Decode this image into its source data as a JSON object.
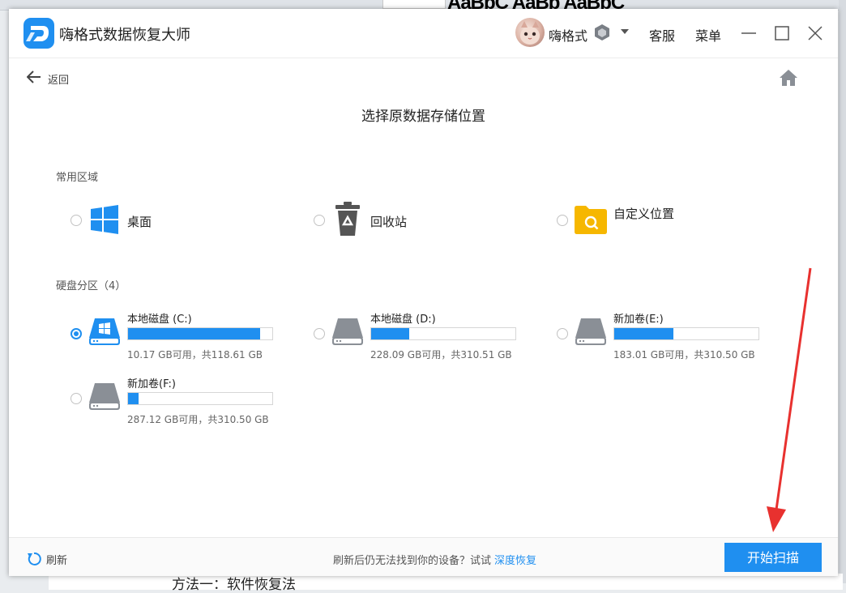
{
  "app": {
    "title": "嗨格式数据恢复大师",
    "user_name": "嗨格式",
    "service_label": "客服",
    "menu_label": "菜单"
  },
  "nav": {
    "back_label": "返回"
  },
  "page": {
    "title": "选择原数据存储位置"
  },
  "common_section": {
    "label": "常用区域",
    "items": [
      {
        "label": "桌面",
        "icon": "windows-icon",
        "selected": false
      },
      {
        "label": "回收站",
        "icon": "recycle-bin-icon",
        "selected": false
      },
      {
        "label": "自定义位置",
        "icon": "folder-search-icon",
        "selected": false
      }
    ]
  },
  "disk_section": {
    "label": "硬盘分区（4）",
    "drives": [
      {
        "name": "本地磁盘 (C:)",
        "info": "10.17 GB可用，共118.61 GB",
        "used_fraction": 0.914,
        "selected": true,
        "system": true
      },
      {
        "name": "本地磁盘 (D:)",
        "info": "228.09 GB可用，共310.51 GB",
        "used_fraction": 0.265,
        "selected": false,
        "system": false
      },
      {
        "name": "新加卷(E:)",
        "info": "183.01 GB可用，共310.50 GB",
        "used_fraction": 0.411,
        "selected": false,
        "system": false
      },
      {
        "name": "新加卷(F:)",
        "info": "287.12 GB可用，共310.50 GB",
        "used_fraction": 0.075,
        "selected": false,
        "system": false
      }
    ]
  },
  "footer": {
    "refresh_label": "刷新",
    "hint": "刷新后仍无法找到你的设备？试试",
    "deep_recovery_link": "深度恢复",
    "scan_button": "开始扫描"
  },
  "background": {
    "doc_text": "方法一：软件恢复法",
    "style_preview": "AaBbC AaBb AaBbC"
  },
  "colors": {
    "accent": "#1f8ff0",
    "annotation_arrow": "#e8312f",
    "folder_yellow": "#f6b700"
  }
}
